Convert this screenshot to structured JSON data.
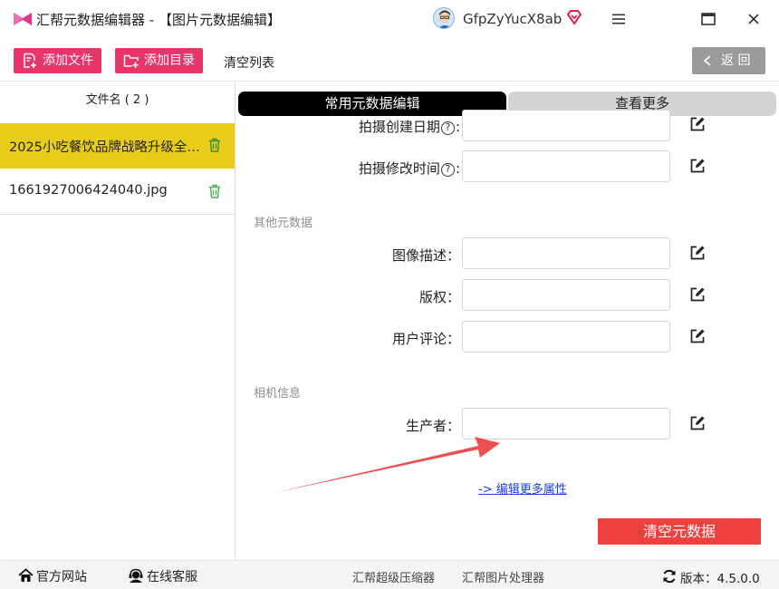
{
  "app": {
    "title": "汇帮元数据编辑器 - 【图片元数据编辑】",
    "username": "GfpZyYucX8ab"
  },
  "toolbar": {
    "add_file": "添加文件",
    "add_dir": "添加目录",
    "clear_list": "清空列表",
    "back": "返 回"
  },
  "file_panel": {
    "header": "文件名 ( 2 )",
    "files": [
      {
        "name": "2025小吃餐饮品牌战略升级全案..."
      },
      {
        "name": "1661927006424040.jpg"
      }
    ]
  },
  "tabs": {
    "common": "常用元数据编辑",
    "more": "查看更多"
  },
  "fields": {
    "shoot_create": {
      "label_a": "拍摄创建日期",
      "label_b": ":",
      "value": ""
    },
    "shoot_modify": {
      "label_a": "拍摄修改时间",
      "label_b": ":",
      "value": ""
    },
    "description": {
      "label": "图像描述：",
      "value": ""
    },
    "copyright": {
      "label": "版权：",
      "value": ""
    },
    "comment": {
      "label": "用户评论：",
      "value": ""
    },
    "maker": {
      "label": "生产者：",
      "value": ""
    }
  },
  "sections": {
    "other": "其他元数据",
    "camera": "相机信息"
  },
  "actions": {
    "more_link": "-> 编辑更多属性",
    "clear_meta": "清空元数据"
  },
  "statusbar": {
    "site": "官方网站",
    "service": "在线客服",
    "compressor": "汇帮超级压缩器",
    "image_tool": "汇帮图片处理器",
    "version_label": "版本：",
    "version": "4.5.0.0"
  },
  "colors": {
    "accent_pink": "#e8356a",
    "selected_file": "#e8cc1a",
    "danger": "#ef4040",
    "link": "#1a3ee8"
  }
}
